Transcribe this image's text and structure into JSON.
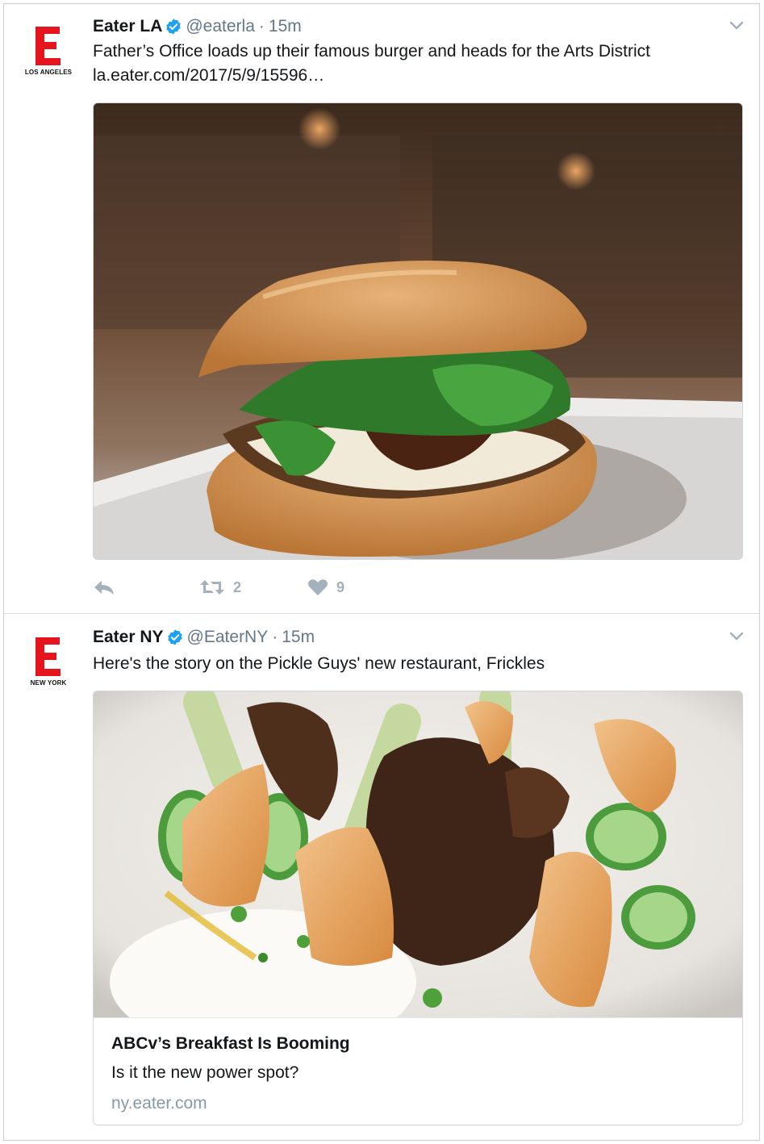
{
  "tweets": [
    {
      "avatar_city": "LOS ANGELES",
      "name": "Eater LA",
      "handle": "@eaterla",
      "separator": "·",
      "time": "15m",
      "text_line1": "Father’s Office loads up their famous burger and heads for the Arts District",
      "text_line2": "la.eater.com/2017/5/9/15596…",
      "actions": {
        "retweets": "2",
        "likes": "9"
      }
    },
    {
      "avatar_city": "NEW YORK",
      "name": "Eater NY",
      "handle": "@EaterNY",
      "separator": "·",
      "time": "15m",
      "text_line1": "Here's the story on the Pickle Guys' new restaurant, Frickles",
      "card": {
        "title": "ABCv’s Breakfast Is Booming",
        "description": "Is it the new power spot?",
        "domain": "ny.eater.com"
      }
    }
  ],
  "colors": {
    "brand_red": "#e6151d",
    "verified_blue": "#1da1f2",
    "muted_text": "#657786",
    "action_gray": "#a4b0bb"
  },
  "icons": [
    "verified-badge-icon",
    "chevron-down-icon",
    "reply-icon",
    "retweet-icon",
    "heart-icon"
  ]
}
